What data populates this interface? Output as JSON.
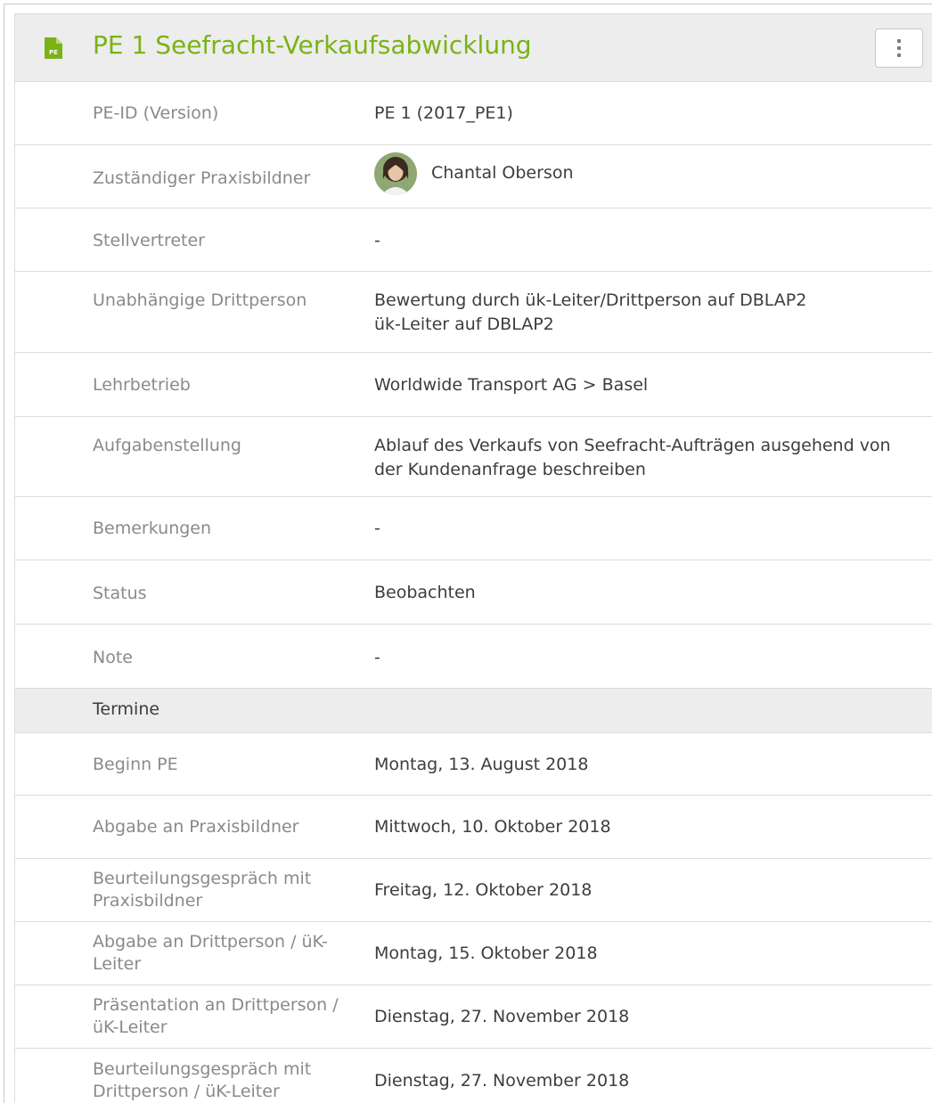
{
  "header": {
    "icon": "document-pe-icon",
    "icon_label": "PE",
    "title": "PE 1 Seefracht-Verkaufsabwicklung",
    "menu_icon": "vertical-ellipsis-icon"
  },
  "colors": {
    "accent": "#7ab317",
    "header_bg": "#ededed",
    "label": "#8a8a8a",
    "value": "#3d3d3d"
  },
  "details": {
    "pe_id": {
      "label": "PE-ID (Version)",
      "value": "PE 1 (2017_PE1)"
    },
    "trainer": {
      "label": "Zuständiger Praxisbildner",
      "value": "Chantal Oberson"
    },
    "deputy": {
      "label": "Stellvertreter",
      "value": "-"
    },
    "third_party": {
      "label": "Unabhängige Drittperson",
      "line1": "Bewertung durch ük-Leiter/Drittperson auf DBLAP2",
      "line2": "ük-Leiter auf DBLAP2"
    },
    "company": {
      "label": "Lehrbetrieb",
      "value": "Worldwide Transport AG > Basel"
    },
    "task": {
      "label": "Aufgabenstellung",
      "line1": "Ablauf des Verkaufs von Seefracht-Aufträgen ausgehend von",
      "line2": "der Kundenanfrage beschreiben"
    },
    "remarks": {
      "label": "Bemerkungen",
      "value": "-"
    },
    "status": {
      "label": "Status",
      "value": "Beobachten"
    },
    "grade": {
      "label": "Note",
      "value": "-"
    }
  },
  "dates": {
    "title": "Termine",
    "start": {
      "label": "Beginn PE",
      "value": "Montag, 13. August 2018"
    },
    "submit_trainer": {
      "label": "Abgabe an Praxisbildner",
      "value": "Mittwoch, 10. Oktober 2018"
    },
    "review_trainer": {
      "label1": "Beurteilungsgespräch mit",
      "label2": "Praxisbildner",
      "value": "Freitag, 12. Oktober 2018"
    },
    "submit_third": {
      "label1": "Abgabe an Drittperson / üK-",
      "label2": "Leiter",
      "value": "Montag, 15. Oktober 2018"
    },
    "presentation": {
      "label1": "Präsentation an Drittperson /",
      "label2": "üK-Leiter",
      "value": "Dienstag, 27. November 2018"
    },
    "review_third": {
      "label1": "Beurteilungsgespräch mit",
      "label2": "Drittperson / üK-Leiter",
      "value": "Dienstag, 27. November 2018"
    }
  }
}
